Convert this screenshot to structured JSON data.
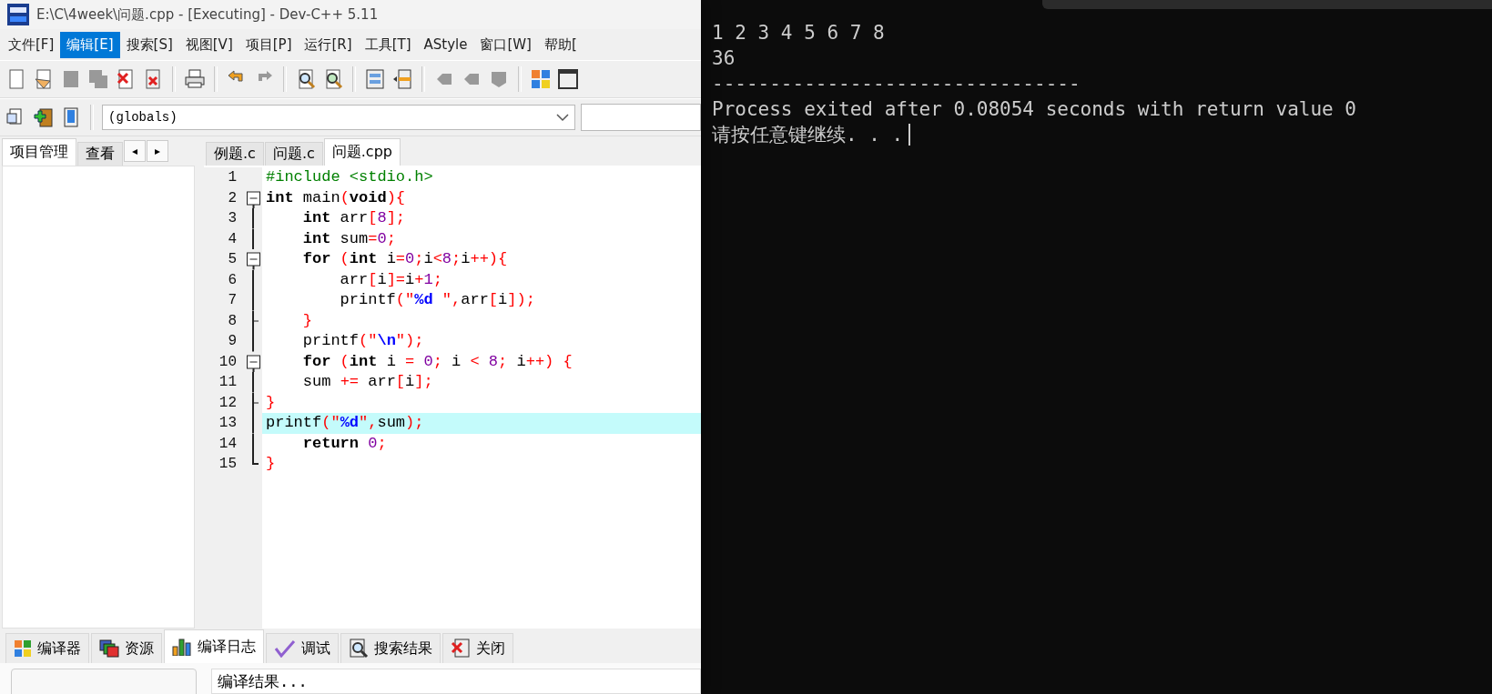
{
  "window": {
    "title": "E:\\C\\4week\\问题.cpp - [Executing] - Dev-C++ 5.11"
  },
  "menu": [
    {
      "label": "文件[F]",
      "selected": false
    },
    {
      "label": "编辑[E]",
      "selected": true
    },
    {
      "label": "搜索[S]",
      "selected": false
    },
    {
      "label": "视图[V]",
      "selected": false
    },
    {
      "label": "项目[P]",
      "selected": false
    },
    {
      "label": "运行[R]",
      "selected": false
    },
    {
      "label": "工具[T]",
      "selected": false
    },
    {
      "label": "AStyle",
      "selected": false
    },
    {
      "label": "窗口[W]",
      "selected": false
    },
    {
      "label": "帮助[",
      "selected": false
    }
  ],
  "scope_select": {
    "value": "(globals)"
  },
  "side_tabs": [
    {
      "label": "项目管理",
      "selected": true
    },
    {
      "label": "查看",
      "selected": false
    }
  ],
  "side_tab_arrows": [
    "◂",
    "▸"
  ],
  "editor_tabs": [
    {
      "label": "例题.c",
      "selected": false
    },
    {
      "label": "问题.c",
      "selected": false
    },
    {
      "label": "问题.cpp",
      "selected": true
    }
  ],
  "code": [
    {
      "number": "1",
      "kind": "plain",
      "highlighted": false,
      "tokens": [
        {
          "kind": "preprocessor",
          "text": "#include <stdio.h>"
        }
      ]
    },
    {
      "number": "2",
      "kind": "fold_start",
      "highlighted": false,
      "tokens": [
        {
          "kind": "keyword",
          "text": "int"
        },
        {
          "kind": "plain",
          "text": " main"
        },
        {
          "kind": "symbol",
          "text": "("
        },
        {
          "kind": "keyword",
          "text": "void"
        },
        {
          "kind": "symbol",
          "text": "){"
        }
      ]
    },
    {
      "number": "3",
      "kind": "fold_body",
      "highlighted": false,
      "tokens": [
        {
          "kind": "keyword",
          "text": "    int"
        },
        {
          "kind": "plain",
          "text": " arr"
        },
        {
          "kind": "symbol",
          "text": "["
        },
        {
          "kind": "number",
          "text": "8"
        },
        {
          "kind": "symbol",
          "text": "];"
        }
      ]
    },
    {
      "number": "4",
      "kind": "fold_body",
      "highlighted": false,
      "tokens": [
        {
          "kind": "keyword",
          "text": "    int"
        },
        {
          "kind": "plain",
          "text": " sum"
        },
        {
          "kind": "symbol",
          "text": "="
        },
        {
          "kind": "number",
          "text": "0"
        },
        {
          "kind": "symbol",
          "text": ";"
        }
      ]
    },
    {
      "number": "5",
      "kind": "fold_start",
      "highlighted": false,
      "tokens": [
        {
          "kind": "keyword",
          "text": "    for"
        },
        {
          "kind": "symbol",
          "text": " ("
        },
        {
          "kind": "keyword",
          "text": "int"
        },
        {
          "kind": "plain",
          "text": " i"
        },
        {
          "kind": "symbol",
          "text": "="
        },
        {
          "kind": "number",
          "text": "0"
        },
        {
          "kind": "symbol",
          "text": ";"
        },
        {
          "kind": "plain",
          "text": "i"
        },
        {
          "kind": "symbol",
          "text": "<"
        },
        {
          "kind": "number",
          "text": "8"
        },
        {
          "kind": "symbol",
          "text": ";"
        },
        {
          "kind": "plain",
          "text": "i"
        },
        {
          "kind": "symbol",
          "text": "++){"
        }
      ]
    },
    {
      "number": "6",
      "kind": "fold_body",
      "highlighted": false,
      "tokens": [
        {
          "kind": "plain",
          "text": "        arr"
        },
        {
          "kind": "symbol",
          "text": "["
        },
        {
          "kind": "plain",
          "text": "i"
        },
        {
          "kind": "symbol",
          "text": "]="
        },
        {
          "kind": "plain",
          "text": "i"
        },
        {
          "kind": "symbol",
          "text": "+"
        },
        {
          "kind": "number",
          "text": "1"
        },
        {
          "kind": "symbol",
          "text": ";"
        }
      ]
    },
    {
      "number": "7",
      "kind": "fold_body",
      "highlighted": false,
      "tokens": [
        {
          "kind": "plain",
          "text": "        printf"
        },
        {
          "kind": "symbol",
          "text": "(\""
        },
        {
          "kind": "string",
          "text": "%d "
        },
        {
          "kind": "symbol",
          "text": "\","
        },
        {
          "kind": "plain",
          "text": "arr"
        },
        {
          "kind": "symbol",
          "text": "["
        },
        {
          "kind": "plain",
          "text": "i"
        },
        {
          "kind": "symbol",
          "text": "]);"
        }
      ]
    },
    {
      "number": "8",
      "kind": "fold_tick",
      "highlighted": false,
      "tokens": [
        {
          "kind": "symbol",
          "text": "    }"
        }
      ]
    },
    {
      "number": "9",
      "kind": "fold_body",
      "highlighted": false,
      "tokens": [
        {
          "kind": "plain",
          "text": "    printf"
        },
        {
          "kind": "symbol",
          "text": "(\""
        },
        {
          "kind": "string",
          "text": "\\n"
        },
        {
          "kind": "symbol",
          "text": "\");"
        }
      ]
    },
    {
      "number": "10",
      "kind": "fold_start",
      "highlighted": false,
      "tokens": [
        {
          "kind": "keyword",
          "text": "    for"
        },
        {
          "kind": "symbol",
          "text": " ("
        },
        {
          "kind": "keyword",
          "text": "int"
        },
        {
          "kind": "plain",
          "text": " i "
        },
        {
          "kind": "symbol",
          "text": "="
        },
        {
          "kind": "number",
          "text": " 0"
        },
        {
          "kind": "symbol",
          "text": ";"
        },
        {
          "kind": "plain",
          "text": " i "
        },
        {
          "kind": "symbol",
          "text": "<"
        },
        {
          "kind": "number",
          "text": " 8"
        },
        {
          "kind": "symbol",
          "text": ";"
        },
        {
          "kind": "plain",
          "text": " i"
        },
        {
          "kind": "symbol",
          "text": "++) {"
        }
      ]
    },
    {
      "number": "11",
      "kind": "fold_body",
      "highlighted": false,
      "tokens": [
        {
          "kind": "plain",
          "text": "    sum "
        },
        {
          "kind": "symbol",
          "text": "+="
        },
        {
          "kind": "plain",
          "text": " arr"
        },
        {
          "kind": "symbol",
          "text": "["
        },
        {
          "kind": "plain",
          "text": "i"
        },
        {
          "kind": "symbol",
          "text": "];"
        }
      ]
    },
    {
      "number": "12",
      "kind": "fold_tick",
      "highlighted": false,
      "tokens": [
        {
          "kind": "symbol",
          "text": "}"
        }
      ]
    },
    {
      "number": "13",
      "kind": "fold_body",
      "highlighted": true,
      "tokens": [
        {
          "kind": "plain",
          "text": "printf"
        },
        {
          "kind": "symbol",
          "text": "(\""
        },
        {
          "kind": "string",
          "text": "%d"
        },
        {
          "kind": "symbol",
          "text": "\","
        },
        {
          "kind": "plain",
          "text": "sum"
        },
        {
          "kind": "symbol",
          "text": ");"
        }
      ]
    },
    {
      "number": "14",
      "kind": "fold_body",
      "highlighted": false,
      "tokens": [
        {
          "kind": "keyword",
          "text": "    return"
        },
        {
          "kind": "number",
          "text": " 0"
        },
        {
          "kind": "symbol",
          "text": ";"
        }
      ]
    },
    {
      "number": "15",
      "kind": "fold_end",
      "highlighted": false,
      "tokens": [
        {
          "kind": "symbol",
          "text": "}"
        }
      ]
    }
  ],
  "bottom_tabs": [
    {
      "label": "编译器",
      "kind": "grid",
      "selected": false
    },
    {
      "label": "资源",
      "kind": "stack",
      "selected": false
    },
    {
      "label": "编译日志",
      "kind": "chart",
      "selected": true
    },
    {
      "label": "调试",
      "kind": "check",
      "selected": false
    },
    {
      "label": "搜索结果",
      "kind": "search",
      "selected": false
    },
    {
      "label": "关闭",
      "kind": "close",
      "selected": false
    }
  ],
  "compile_output": {
    "value": "编译结果..."
  },
  "console": {
    "lines": [
      "1 2 3 4 5 6 7 8",
      "36",
      "--------------------------------",
      "Process exited after 0.08054 seconds with return value 0",
      "请按任意键继续. . ."
    ]
  }
}
